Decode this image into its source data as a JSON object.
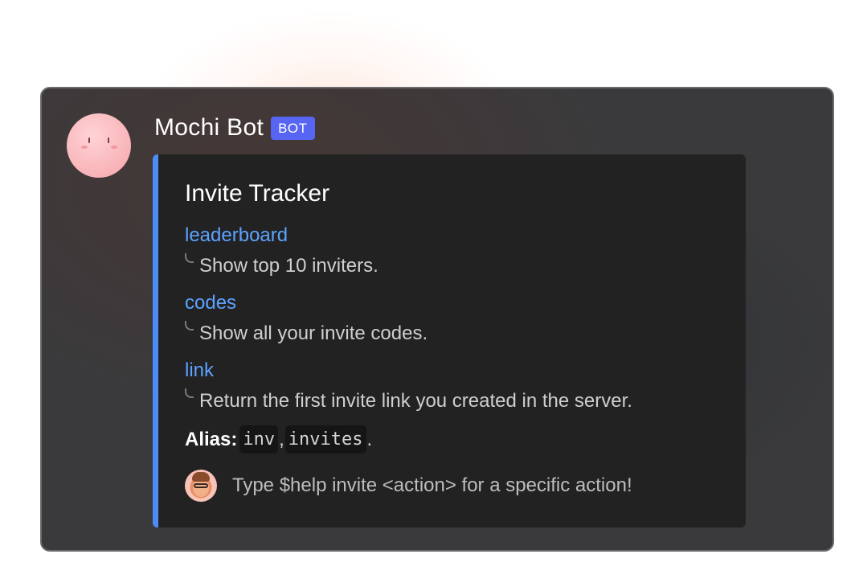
{
  "message": {
    "author": "Mochi Bot",
    "badge": "BOT",
    "avatar_icon": "mochi-face-icon"
  },
  "embed": {
    "accent_color": "#4c8cf5",
    "title": "Invite Tracker",
    "commands": [
      {
        "name": "leaderboard",
        "description": "Show top 10 inviters."
      },
      {
        "name": "codes",
        "description": "Show all your invite codes."
      },
      {
        "name": "link",
        "description": "Return the first invite link you created in the server."
      }
    ],
    "alias": {
      "label": "Alias:",
      "values": [
        "inv",
        "invites"
      ],
      "separator": ",",
      "end": "."
    },
    "footer": {
      "text": "Type $help invite <action> for a specific action!",
      "icon": "memoji-avatar-icon"
    }
  },
  "colors": {
    "badge": "#5865f2",
    "link": "#5ca3ff",
    "card_bg": "#3a3a3c",
    "embed_bg": "#222223"
  }
}
